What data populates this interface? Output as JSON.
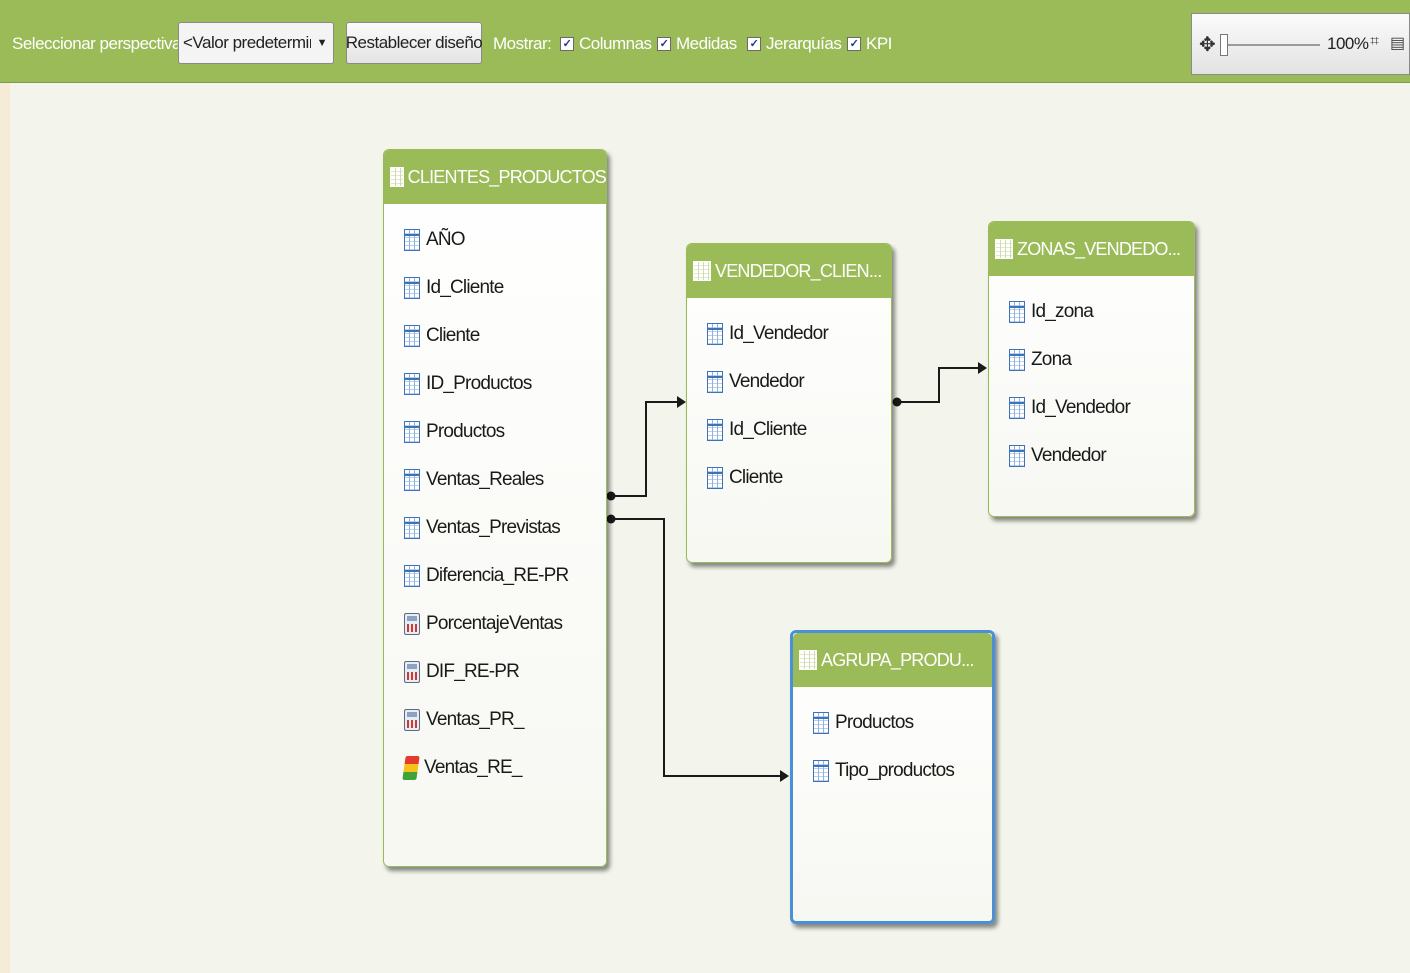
{
  "toolbar": {
    "perspective_label": "Seleccionar perspectiva:",
    "perspective_value": "<Valor predetermina",
    "reset_label": "Restablecer diseño",
    "show_label": "Mostrar:",
    "checkboxes": [
      {
        "label": "Columnas",
        "checked": true
      },
      {
        "label": "Medidas",
        "checked": true
      },
      {
        "label": "Jerarquías",
        "checked": true
      },
      {
        "label": "KPI",
        "checked": true
      }
    ],
    "zoom": "100%"
  },
  "tables": [
    {
      "title": "CLIENTES_PRODUCTOS",
      "columns": [
        {
          "name": "AÑO",
          "icon": "column-icon"
        },
        {
          "name": "Id_Cliente",
          "icon": "column-icon"
        },
        {
          "name": "Cliente",
          "icon": "column-icon"
        },
        {
          "name": "ID_Productos",
          "icon": "column-icon"
        },
        {
          "name": "Productos",
          "icon": "column-icon"
        },
        {
          "name": "Ventas_Reales",
          "icon": "column-icon"
        },
        {
          "name": "Ventas_Previstas",
          "icon": "column-icon"
        },
        {
          "name": "Diferencia_RE-PR",
          "icon": "column-icon"
        },
        {
          "name": "PorcentajeVentas",
          "icon": "measure-icon"
        },
        {
          "name": "DIF_RE-PR",
          "icon": "measure-icon"
        },
        {
          "name": "Ventas_PR_",
          "icon": "measure-icon"
        },
        {
          "name": "Ventas_RE_",
          "icon": "kpi-icon"
        }
      ]
    },
    {
      "title": "VENDEDOR_CLIEN...",
      "columns": [
        {
          "name": "Id_Vendedor",
          "icon": "column-icon"
        },
        {
          "name": "Vendedor",
          "icon": "column-icon"
        },
        {
          "name": "Id_Cliente",
          "icon": "column-icon"
        },
        {
          "name": "Cliente",
          "icon": "column-icon"
        }
      ]
    },
    {
      "title": "ZONAS_VENDEDO...",
      "columns": [
        {
          "name": "Id_zona",
          "icon": "column-icon"
        },
        {
          "name": "Zona",
          "icon": "column-icon"
        },
        {
          "name": "Id_Vendedor",
          "icon": "column-icon"
        },
        {
          "name": "Vendedor",
          "icon": "column-icon"
        }
      ]
    },
    {
      "title": "AGRUPA_PRODU...",
      "selected": true,
      "columns": [
        {
          "name": "Productos",
          "icon": "column-icon"
        },
        {
          "name": "Tipo_productos",
          "icon": "column-icon"
        }
      ]
    }
  ]
}
